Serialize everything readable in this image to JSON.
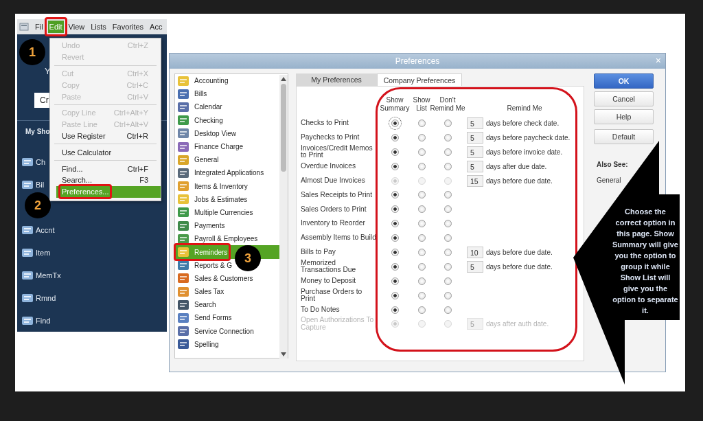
{
  "left_app": {
    "menu_bar": [
      {
        "label": "Fil",
        "selected": false
      },
      {
        "label": "Edit",
        "selected": true
      },
      {
        "label": "View",
        "selected": false
      },
      {
        "label": "Lists",
        "selected": false
      },
      {
        "label": "Favorites",
        "selected": false
      },
      {
        "label": "Acc",
        "selected": false
      }
    ],
    "sidebar": {
      "greeting": "Y",
      "create_button": "Cr",
      "section": "My Sho",
      "items": [
        {
          "label": "Ch"
        },
        {
          "label": "Bil"
        },
        {
          "label": "Accnt"
        },
        {
          "label": "Item"
        },
        {
          "label": "MemTx"
        },
        {
          "label": "Rmnd"
        },
        {
          "label": "Find"
        }
      ]
    },
    "edit_menu": [
      {
        "kind": "item",
        "label": "Undo",
        "shortcut": "Ctrl+Z",
        "disabled": true,
        "selected": false
      },
      {
        "kind": "item",
        "label": "Revert",
        "disabled": true,
        "selected": false
      },
      {
        "kind": "separator"
      },
      {
        "kind": "item",
        "label": "Cut",
        "shortcut": "Ctrl+X",
        "disabled": true,
        "selected": false
      },
      {
        "kind": "item",
        "label": "Copy",
        "shortcut": "Ctrl+C",
        "disabled": true,
        "selected": false
      },
      {
        "kind": "item",
        "label": "Paste",
        "shortcut": "Ctrl+V",
        "disabled": true,
        "selected": false
      },
      {
        "kind": "separator"
      },
      {
        "kind": "item",
        "label": "Copy Line",
        "shortcut": "Ctrl+Alt+Y",
        "disabled": true,
        "selected": false
      },
      {
        "kind": "item",
        "label": "Paste Line",
        "shortcut": "Ctrl+Alt+V",
        "disabled": true,
        "selected": false
      },
      {
        "kind": "item",
        "label": "Use Register",
        "shortcut": "Ctrl+R",
        "disabled": false,
        "selected": false
      },
      {
        "kind": "separator"
      },
      {
        "kind": "item",
        "label": "Use Calculator",
        "disabled": false,
        "selected": false
      },
      {
        "kind": "separator"
      },
      {
        "kind": "item",
        "label": "Find...",
        "shortcut": "Ctrl+F",
        "disabled": false,
        "selected": false
      },
      {
        "kind": "item",
        "label": "Search...",
        "shortcut": "F3",
        "disabled": false,
        "selected": false
      },
      {
        "kind": "item",
        "label": "Preferences...",
        "disabled": false,
        "selected": true
      }
    ]
  },
  "preferences_dialog": {
    "title": "Preferences",
    "close": "×",
    "categories": [
      {
        "label": "Accounting",
        "selected": false
      },
      {
        "label": "Bills",
        "selected": false
      },
      {
        "label": "Calendar",
        "selected": false
      },
      {
        "label": "Checking",
        "selected": false
      },
      {
        "label": "Desktop View",
        "selected": false
      },
      {
        "label": "Finance Charge",
        "selected": false
      },
      {
        "label": "General",
        "selected": false
      },
      {
        "label": "Integrated Applications",
        "selected": false
      },
      {
        "label": "Items & Inventory",
        "selected": false
      },
      {
        "label": "Jobs & Estimates",
        "selected": false
      },
      {
        "label": "Multiple Currencies",
        "selected": false
      },
      {
        "label": "Payments",
        "selected": false
      },
      {
        "label": "Payroll & Employees",
        "selected": false
      },
      {
        "label": "Reminders",
        "selected": true
      },
      {
        "label": "Reports & G",
        "selected": false
      },
      {
        "label": "Sales & Customers",
        "selected": false
      },
      {
        "label": "Sales Tax",
        "selected": false
      },
      {
        "label": "Search",
        "selected": false
      },
      {
        "label": "Send Forms",
        "selected": false
      },
      {
        "label": "Service Connection",
        "selected": false
      },
      {
        "label": "Spelling",
        "selected": false
      }
    ],
    "tabs": [
      {
        "label": "My Preferences",
        "selected": false
      },
      {
        "label": "Company Preferences",
        "selected": true
      }
    ],
    "columns": [
      "Show Summary",
      "Show List",
      "Don't Remind Me",
      "Remind Me"
    ],
    "rows": [
      {
        "label": "Checks to Print",
        "disabled": false,
        "options": [
          {
            "selected": true
          },
          {
            "selected": false
          },
          {
            "selected": false
          }
        ],
        "days": "5",
        "remind_text": "days before check date."
      },
      {
        "label": "Paychecks to Print",
        "disabled": false,
        "options": [
          {
            "selected": true
          },
          {
            "selected": false
          },
          {
            "selected": false
          }
        ],
        "days": "5",
        "remind_text": "days before paycheck date."
      },
      {
        "label": "Invoices/Credit Memos to Print",
        "disabled": false,
        "options": [
          {
            "selected": true
          },
          {
            "selected": false
          },
          {
            "selected": false
          }
        ],
        "days": "5",
        "remind_text": "days before invoice date."
      },
      {
        "label": "Overdue Invoices",
        "disabled": false,
        "options": [
          {
            "selected": true
          },
          {
            "selected": false
          },
          {
            "selected": false
          }
        ],
        "days": "5",
        "remind_text": "days after due date."
      },
      {
        "label": "Almost Due Invoices",
        "disabled": false,
        "options": [
          {
            "selected": true
          },
          {
            "selected": false
          },
          {
            "selected": false
          }
        ],
        "options_disabled": true,
        "days": "15",
        "remind_text": "days before due date."
      },
      {
        "label": "Sales Receipts to Print",
        "disabled": false,
        "options": [
          {
            "selected": true
          },
          {
            "selected": false
          },
          {
            "selected": false
          }
        ]
      },
      {
        "label": "Sales Orders to Print",
        "disabled": false,
        "options": [
          {
            "selected": true
          },
          {
            "selected": false
          },
          {
            "selected": false
          }
        ]
      },
      {
        "label": "Inventory to Reorder",
        "disabled": false,
        "options": [
          {
            "selected": true
          },
          {
            "selected": false
          },
          {
            "selected": false
          }
        ]
      },
      {
        "label": "Assembly Items to Build",
        "disabled": false,
        "options": [
          {
            "selected": true
          },
          {
            "selected": false
          },
          {
            "selected": false
          }
        ]
      },
      {
        "label": "Bills to Pay",
        "disabled": false,
        "options": [
          {
            "selected": true
          },
          {
            "selected": false
          },
          {
            "selected": false
          }
        ],
        "days": "10",
        "remind_text": "days before due date."
      },
      {
        "label": "Memorized Transactions Due",
        "disabled": false,
        "options": [
          {
            "selected": true
          },
          {
            "selected": false
          },
          {
            "selected": false
          }
        ],
        "days": "5",
        "remind_text": "days before due date."
      },
      {
        "label": "Money to Deposit",
        "disabled": false,
        "options": [
          {
            "selected": true
          },
          {
            "selected": false
          },
          {
            "selected": false
          }
        ]
      },
      {
        "label": "Purchase Orders to Print",
        "disabled": false,
        "options": [
          {
            "selected": true
          },
          {
            "selected": false
          },
          {
            "selected": false
          }
        ]
      },
      {
        "label": "To Do Notes",
        "disabled": false,
        "options": [
          {
            "selected": true
          },
          {
            "selected": false
          },
          {
            "selected": false
          }
        ]
      },
      {
        "label": "Open Authorizations To Capture",
        "disabled": true,
        "options": [
          {
            "selected": true
          },
          {
            "selected": false
          },
          {
            "selected": false
          }
        ],
        "days": "5",
        "remind_text": "days after auth date."
      }
    ],
    "buttons": [
      {
        "label": "OK",
        "kind": "default"
      },
      {
        "label": "Cancel",
        "kind": "normal"
      },
      {
        "label": "Help",
        "kind": "normal"
      },
      {
        "label": "Default",
        "kind": "normal"
      }
    ],
    "also_see": {
      "heading": "Also See:",
      "links": [
        "General"
      ]
    }
  },
  "annotations": {
    "badges": [
      "1",
      "2",
      "3"
    ],
    "callout": "Choose the correct option in this page. Show Summary will give you the option to group it while Show List will give you the option to separate it."
  }
}
